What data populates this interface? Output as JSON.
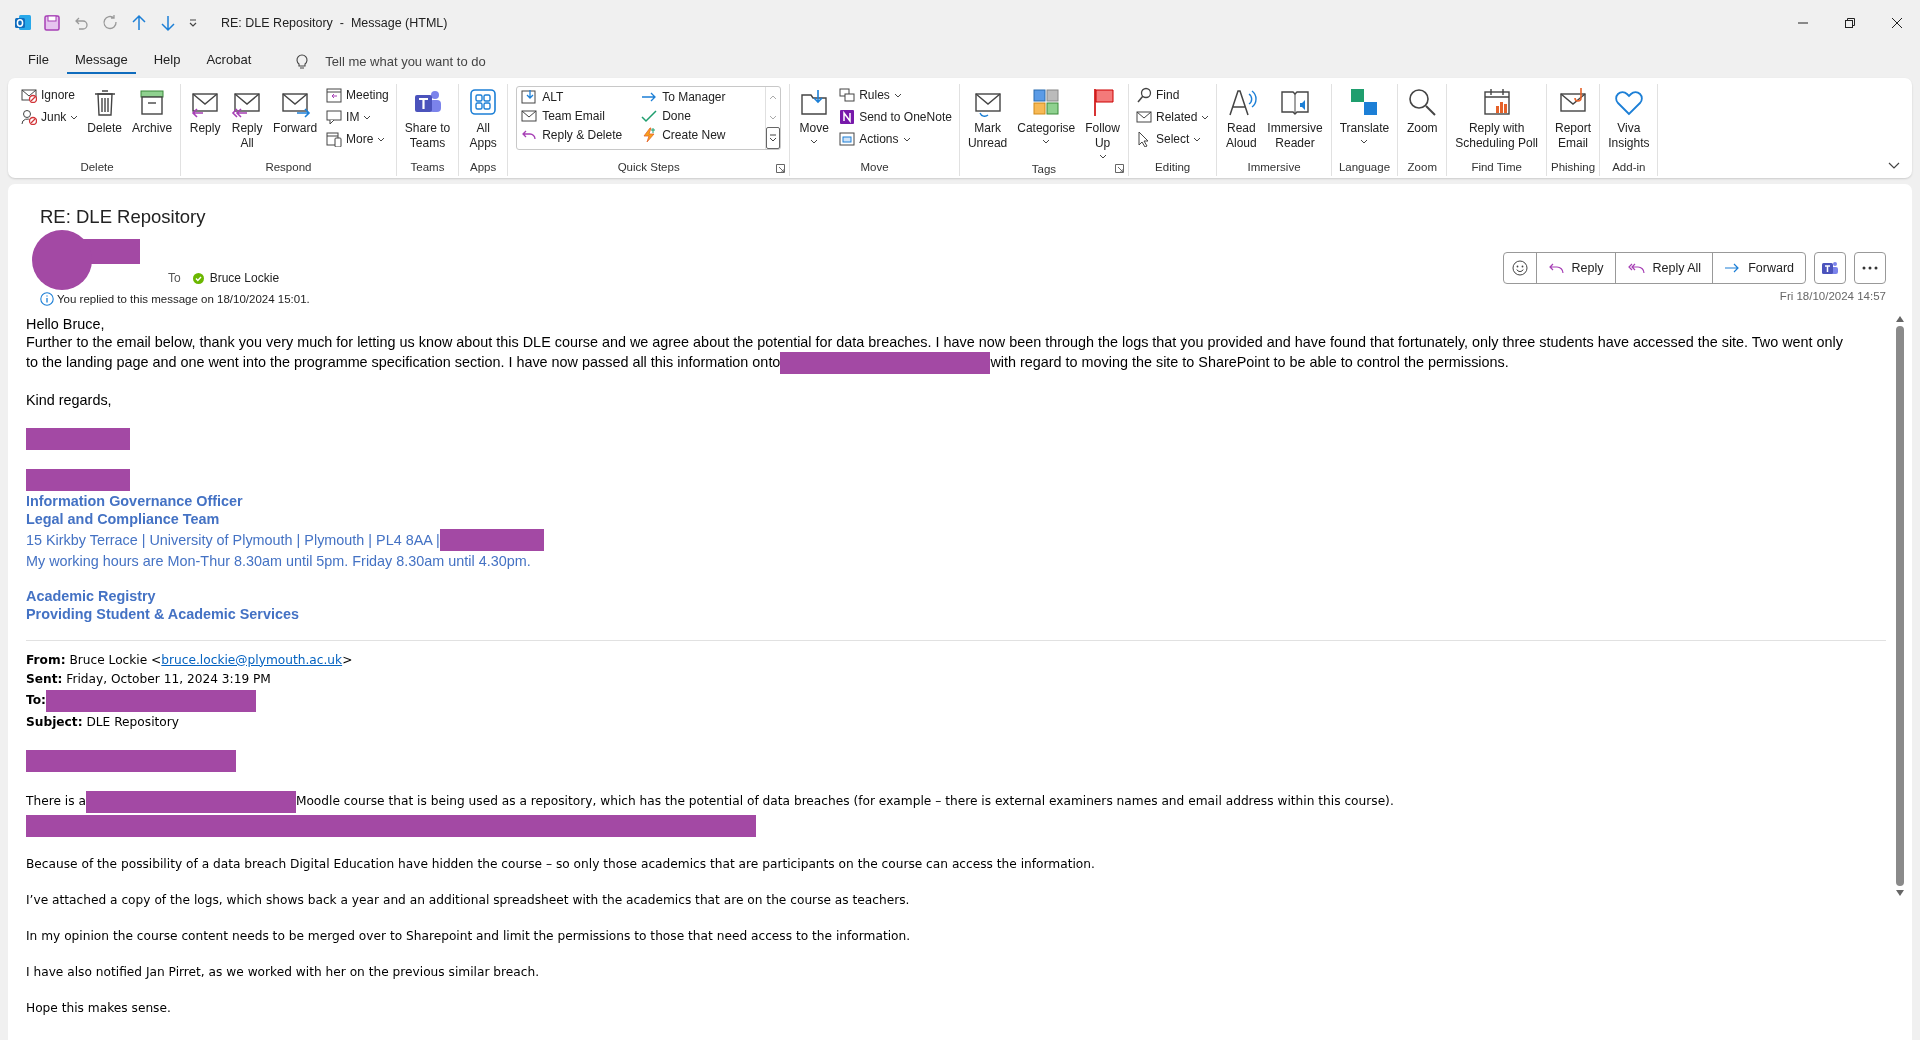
{
  "window": {
    "title": "RE: DLE Repository  -  Message (HTML)"
  },
  "menu_tabs": [
    {
      "label": "File",
      "selected": false
    },
    {
      "label": "Message",
      "selected": true
    },
    {
      "label": "Help",
      "selected": false
    },
    {
      "label": "Acrobat",
      "selected": false
    }
  ],
  "tell_me": {
    "placeholder": "Tell me what you want to do"
  },
  "ribbon": [
    {
      "label": "Delete",
      "items": [
        {
          "kind": "stack",
          "items": [
            {
              "label": "Ignore",
              "dropdown": false
            },
            {
              "label": "Junk",
              "dropdown": true
            }
          ]
        },
        {
          "kind": "large",
          "lines": [
            "Delete"
          ],
          "dropdown": false
        },
        {
          "kind": "large",
          "lines": [
            "Archive"
          ],
          "dropdown": false
        }
      ]
    },
    {
      "label": "Respond",
      "items": [
        {
          "kind": "large",
          "lines": [
            "Reply"
          ],
          "dropdown": false
        },
        {
          "kind": "large",
          "lines": [
            "Reply",
            "All"
          ],
          "dropdown": false
        },
        {
          "kind": "large",
          "lines": [
            "Forward"
          ],
          "dropdown": false
        },
        {
          "kind": "stack",
          "items": [
            {
              "label": "Meeting",
              "dropdown": false
            },
            {
              "label": "IM",
              "dropdown": true
            },
            {
              "label": "More",
              "dropdown": true
            }
          ]
        }
      ]
    },
    {
      "label": "Teams",
      "items": [
        {
          "kind": "large",
          "lines": [
            "Share to",
            "Teams"
          ],
          "dropdown": false
        }
      ]
    },
    {
      "label": "Apps",
      "items": [
        {
          "kind": "large",
          "lines": [
            "All",
            "Apps"
          ],
          "dropdown": false
        }
      ]
    },
    {
      "label": "Quick Steps",
      "launcher": true,
      "items": [
        {
          "kind": "gallery",
          "items": [
            {
              "label": "ALT"
            },
            {
              "label": "To Manager"
            },
            {
              "label": "Team Email"
            },
            {
              "label": "Done"
            },
            {
              "label": "Reply & Delete"
            },
            {
              "label": "Create New"
            }
          ]
        }
      ]
    },
    {
      "label": "Move",
      "items": [
        {
          "kind": "large",
          "lines": [
            "Move"
          ],
          "dropdown": true
        },
        {
          "kind": "stack",
          "items": [
            {
              "label": "Rules",
              "dropdown": true
            },
            {
              "label": "Send to OneNote",
              "dropdown": false
            },
            {
              "label": "Actions",
              "dropdown": true
            }
          ]
        }
      ]
    },
    {
      "label": "Tags",
      "launcher": true,
      "items": [
        {
          "kind": "large",
          "lines": [
            "Mark",
            "Unread"
          ],
          "dropdown": false
        },
        {
          "kind": "large",
          "lines": [
            "Categorise"
          ],
          "dropdown": true
        },
        {
          "kind": "large",
          "lines": [
            "Follow",
            "Up"
          ],
          "dropdown": true
        }
      ]
    },
    {
      "label": "Editing",
      "items": [
        {
          "kind": "stack",
          "items": [
            {
              "label": "Find",
              "dropdown": false
            },
            {
              "label": "Related",
              "dropdown": true
            },
            {
              "label": "Select",
              "dropdown": true
            }
          ]
        }
      ]
    },
    {
      "label": "Immersive",
      "items": [
        {
          "kind": "large",
          "lines": [
            "Read",
            "Aloud"
          ],
          "dropdown": false
        },
        {
          "kind": "large",
          "lines": [
            "Immersive",
            "Reader"
          ],
          "dropdown": false
        }
      ]
    },
    {
      "label": "Language",
      "items": [
        {
          "kind": "large",
          "lines": [
            "Translate"
          ],
          "dropdown": true
        }
      ]
    },
    {
      "label": "Zoom",
      "items": [
        {
          "kind": "large",
          "lines": [
            "Zoom"
          ],
          "dropdown": false
        }
      ]
    },
    {
      "label": "Find Time",
      "items": [
        {
          "kind": "large",
          "lines": [
            "Reply with",
            "Scheduling Poll"
          ],
          "dropdown": false
        }
      ]
    },
    {
      "label": "Phishing",
      "items": [
        {
          "kind": "large",
          "lines": [
            "Report",
            "Email"
          ],
          "dropdown": false
        }
      ]
    },
    {
      "label": "Add-in",
      "items": [
        {
          "kind": "large",
          "lines": [
            "Viva",
            "Insights"
          ],
          "dropdown": false
        }
      ]
    }
  ],
  "message": {
    "subject": "RE: DLE Repository",
    "sender_redacted": true,
    "to_label": "To",
    "recipient": "Bruce Lockie",
    "notice": "You replied to this message on 18/10/2024 15:01.",
    "actions": [
      {
        "label": "Reply"
      },
      {
        "label": "Reply All"
      },
      {
        "label": "Forward"
      }
    ],
    "date": "Fri 18/10/2024 14:57"
  },
  "body": {
    "reply": [
      [
        [
          {
            "text": "Hello Bruce,"
          }
        ],
        [
          {
            "text": "Further to the email below, thank you very much for letting us know about this DLE course and we agree about the potential for data breaches. I have now been through the logs that you provided and have found that fortunately, only three students have accessed the site. Two went only"
          }
        ],
        [
          {
            "text": "to the landing page and one went into the programme specification section. I have now passed all this information onto"
          },
          {
            "kind": "longmask"
          },
          {
            "text": "with regard to moving the site to SharePoint to be able to control the permissions."
          }
        ]
      ],
      [
        [
          {
            "text": "Kind regards,"
          }
        ]
      ],
      [
        [
          {
            "kind": "mask"
          }
        ]
      ]
    ],
    "signature": [
      [
        [
          {
            "kind": "mask"
          }
        ],
        [
          {
            "text": "**Information Governance Officer**"
          }
        ],
        [
          {
            "text": "**Legal and Compliance Team**"
          }
        ],
        [
          {
            "text": "15 Kirkby Terrace | University of Plymouth | Plymouth | PL4 8AA |"
          },
          {
            "kind": "mask"
          }
        ],
        [
          {
            "text": "My working hours are Mon-Thur 8.30am until 5pm. Friday 8.30am until 4.30pm."
          }
        ]
      ],
      [
        [
          {
            "text": "**Academic Registry**"
          }
        ],
        [
          {
            "text": "**Providing Student & Academic Services**"
          }
        ]
      ]
    ],
    "quoted_header": [
      [
        {
          "text": "**From:** Bruce Lockie <"
        },
        {
          "kind": "link",
          "text": "bruce.lockie@plymouth.ac.uk"
        },
        {
          "text": ">"
        }
      ],
      [
        {
          "text": "**Sent:** Friday, October 11, 2024 3:19 PM"
        }
      ],
      [
        {
          "text": "**To:**"
        },
        {
          "kind": "longmask"
        }
      ],
      [
        {
          "text": "**Subject:** DLE Repository"
        }
      ]
    ],
    "quoted": [
      [
        [
          {
            "kind": "longmask"
          }
        ]
      ],
      [
        [
          {
            "text": "There is a"
          },
          {
            "kind": "longmask"
          },
          {
            "text": "Moodle course that is being used as a repository, which has the potential of data breaches (for example – there is external examiners names and email address within this course)."
          }
        ],
        [
          {
            "kind": "linemask"
          }
        ]
      ],
      [
        [
          {
            "text": "Because of the possibility of a data breach Digital Education have hidden the course – so only those academics that are participants on the course can access the information."
          }
        ]
      ],
      [
        [
          {
            "text": "I’ve attached a copy of the logs, which shows back a year and an additional spreadsheet with the academics that are on the course as teachers."
          }
        ]
      ],
      [
        [
          {
            "text": "In my opinion the course content needs to be merged over to Sharepoint and limit the permissions to those that need access to the information."
          }
        ]
      ],
      [
        [
          {
            "text": "I have also notified Jan Pirret, as we worked with her on the previous similar breach."
          }
        ]
      ],
      [
        [
          {
            "text": "Hope this makes sense."
          }
        ]
      ]
    ]
  }
}
